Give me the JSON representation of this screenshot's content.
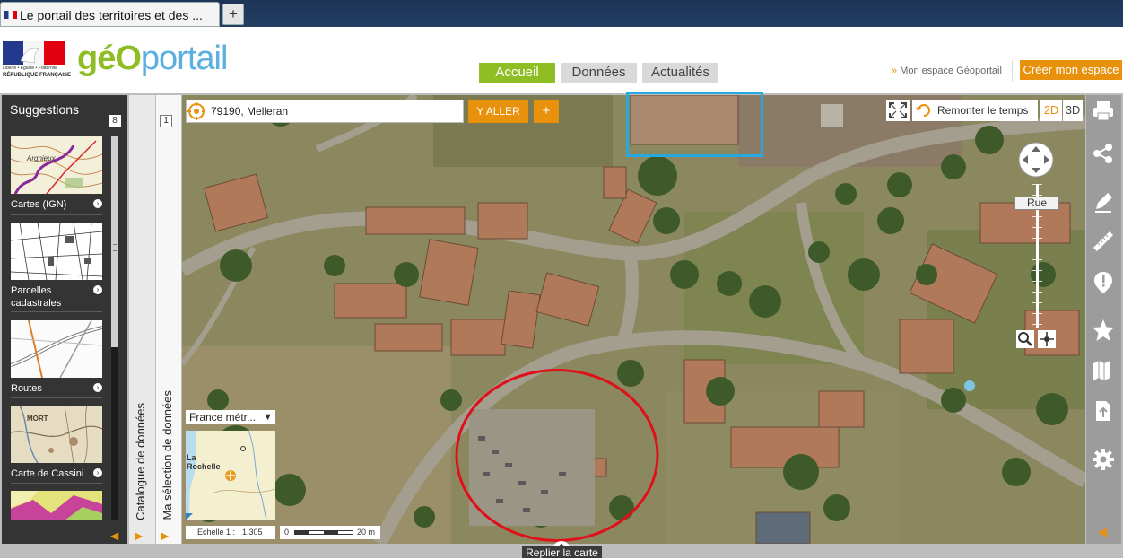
{
  "browser": {
    "tab_title": "Le portail des territoires et des ...",
    "new_tab_icon": "+"
  },
  "header": {
    "logo_geo": "géO",
    "logo_portail": "portail",
    "marianne_lines": [
      "Liberté • Égalité • Fraternité",
      "RÉPUBLIQUE FRANÇAISE"
    ],
    "nav": [
      {
        "label": "Accueil",
        "active": true
      },
      {
        "label": "Données",
        "active": false
      },
      {
        "label": "Actualités",
        "active": false
      }
    ],
    "espace_arrow": "»",
    "espace_link": "Mon espace Géoportail",
    "creer_button": "Créer mon espace"
  },
  "sidebar": {
    "title": "Suggestions",
    "count": "8",
    "layers": [
      {
        "label": "Cartes (IGN)"
      },
      {
        "label": "Parcelles cadastrales"
      },
      {
        "label": "Routes"
      },
      {
        "label": "Carte de Cassini"
      }
    ],
    "thumb_texts": {
      "cartes": "Argnieux",
      "cassini": "MORT"
    },
    "collapse_arrow": "◀",
    "catalogue_label": "Catalogue de données",
    "selection_label": "Ma sélection de données",
    "selection_count": "1",
    "expand_arrow": "▶"
  },
  "search": {
    "value": "79190, Melleran",
    "go_button": "Y ALLER",
    "plus_button": "+"
  },
  "map_controls": {
    "remonter_label": "Remonter le temps",
    "mode_2d": "2D",
    "mode_3d": "3D",
    "zoom_level_label": "Rue"
  },
  "overview": {
    "select_value": "France métr...",
    "select_arrow": "▼",
    "city_label_line1": "La",
    "city_label_line2": "Rochelle"
  },
  "scale": {
    "ratio_label": "Echelle 1 :",
    "ratio_value": "1.305",
    "bar_start": "0",
    "bar_end": "20 m"
  },
  "right_toolbar": {
    "icons": [
      "print-icon",
      "share-icon",
      "pencil-icon",
      "ruler-icon",
      "alert-icon",
      "star-icon",
      "map-icon",
      "upload-icon",
      "gear-icon"
    ],
    "collapse_arrow": "◀"
  },
  "bottom": {
    "replier_label": "Replier la carte"
  },
  "colors": {
    "accent_orange": "#e8910d",
    "nav_active_green": "#8fbd24",
    "highlight_blue": "#26a9e0",
    "highlight_red": "#e0101a"
  }
}
